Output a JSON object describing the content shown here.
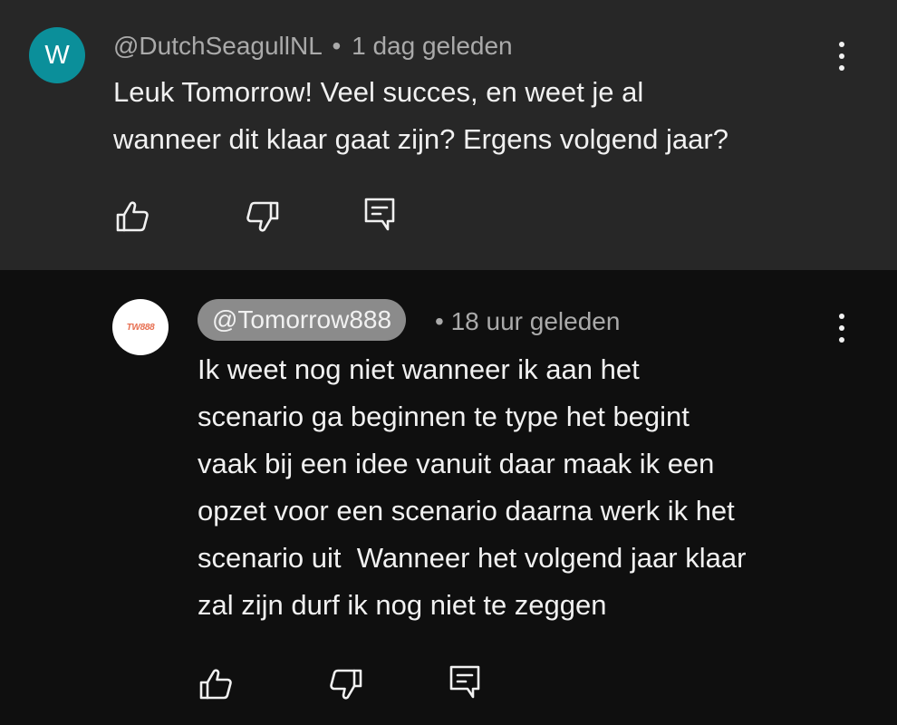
{
  "comment": {
    "avatar_letter": "W",
    "author": "@DutchSeagullNL",
    "separator": "•",
    "time": "1 dag geleden",
    "text": "Leuk Tomorrow! Veel succes, en weet je al\nwanneer dit klaar gaat zijn? Ergens volgend jaar?",
    "avatar_color": "#0b8f9a"
  },
  "reply": {
    "avatar_logo_text": "TW888",
    "author": "@Tomorrow888",
    "separator": "•",
    "time": "18 uur geleden",
    "text": "Ik weet nog niet wanneer ik aan het\nscenario ga beginnen te type het begint\nvaak bij een idee vanuit daar maak ik een\nopzet voor een scenario daarna werk ik het\nscenario uit  Wanneer het volgend jaar klaar\nzal zijn durf ik nog niet te zeggen"
  },
  "icons": {
    "like": "thumb-up-icon",
    "dislike": "thumb-down-icon",
    "reply": "comment-reply-icon",
    "more": "more-vert-icon"
  },
  "colors": {
    "top_background": "#272727",
    "reply_background": "#0f0f0f",
    "handle_pill": "#8b8b8b",
    "meta_text": "#aaaaaa",
    "body_text": "#f1f1f1"
  }
}
